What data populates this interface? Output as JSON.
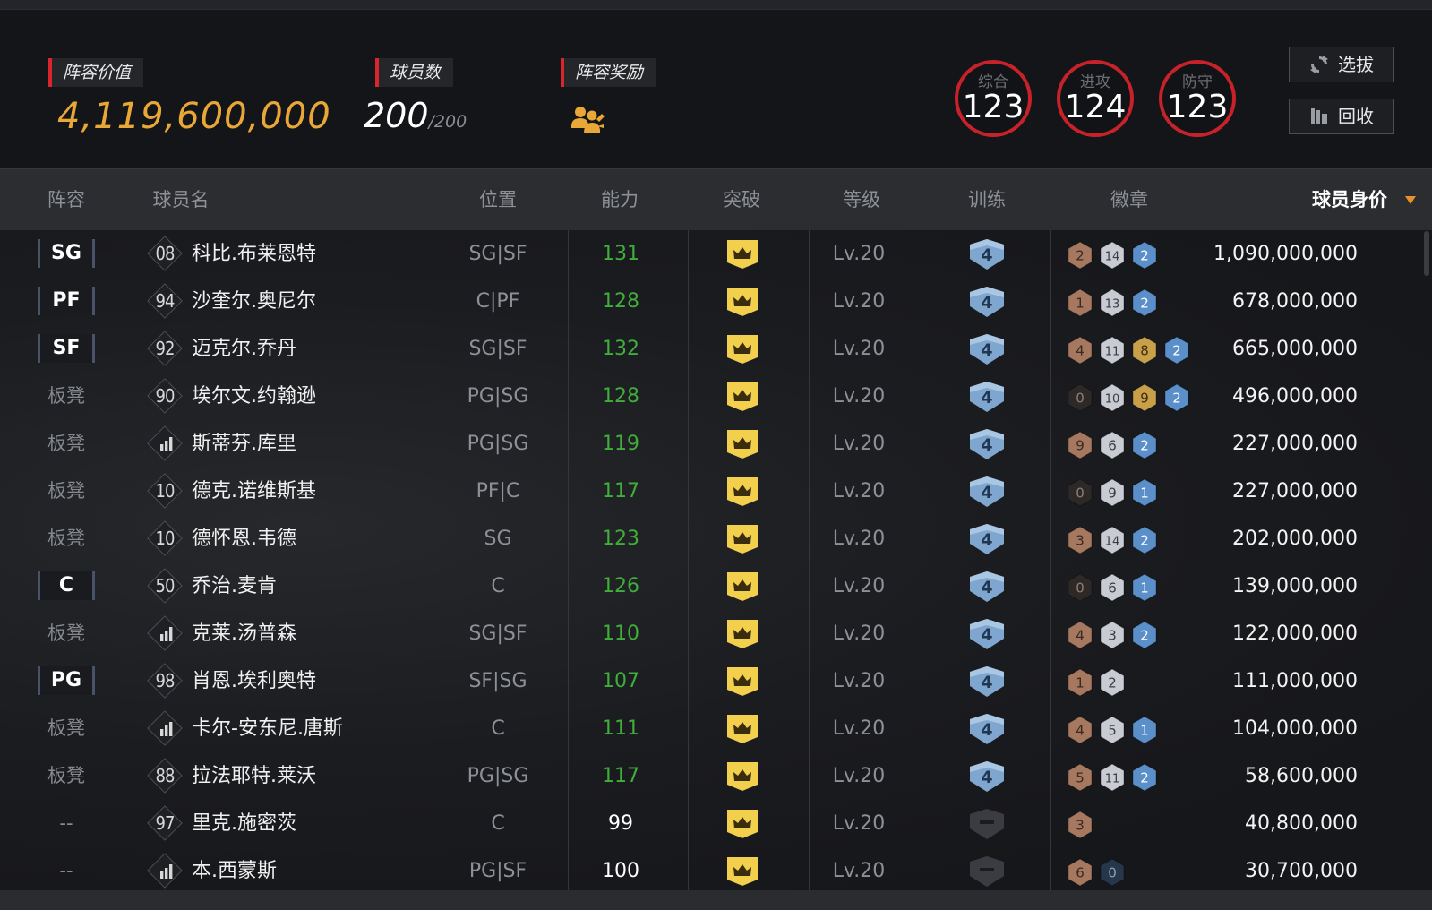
{
  "header": {
    "roster_value_label": "阵容价值",
    "roster_value": "4,119,600,000",
    "player_count_label": "球员数",
    "player_count": "200",
    "player_count_max": "/200",
    "roster_reward_label": "阵容奖励",
    "reward_icon": "team-reward-icon",
    "ratings": [
      {
        "label": "综合",
        "value": "123"
      },
      {
        "label": "进攻",
        "value": "124"
      },
      {
        "label": "防守",
        "value": "123"
      }
    ],
    "buttons": {
      "select": "选拔",
      "recycle": "回收"
    }
  },
  "columns": {
    "lineup": "阵容",
    "name": "球员名",
    "position": "位置",
    "ability": "能力",
    "breakthrough": "突破",
    "level": "等级",
    "training": "训练",
    "badges": "徽章",
    "value": "球员身价"
  },
  "colors": {
    "accent_red": "#d8262c",
    "gold": "#e9a737",
    "ability_green": "#3fae3a",
    "sort_arrow": "#e9902b",
    "badge_bronze": "#a5785f",
    "badge_silver": "#c8cbd2",
    "badge_gold": "#c9a04a",
    "badge_blue": "#5b8fca",
    "badge_dark": "#2e2926",
    "badge_darkblue": "#27364a"
  },
  "players": [
    {
      "lineup": "SG",
      "starter": true,
      "jersey": "08",
      "name": "科比.布莱恩特",
      "position": "SG|SF",
      "ability": "131",
      "level": "Lv.20",
      "training": "4",
      "value": "1,090,000,000",
      "badges": [
        {
          "value": "2",
          "tier": "bronze"
        },
        {
          "value": "14",
          "tier": "silver"
        },
        {
          "value": "2",
          "tier": "blue"
        }
      ]
    },
    {
      "lineup": "PF",
      "starter": true,
      "jersey": "94",
      "name": "沙奎尔.奥尼尔",
      "position": "C|PF",
      "ability": "128",
      "level": "Lv.20",
      "training": "4",
      "value": "678,000,000",
      "badges": [
        {
          "value": "1",
          "tier": "bronze"
        },
        {
          "value": "13",
          "tier": "silver"
        },
        {
          "value": "2",
          "tier": "blue"
        }
      ]
    },
    {
      "lineup": "SF",
      "starter": true,
      "jersey": "92",
      "name": "迈克尔.乔丹",
      "position": "SG|SF",
      "ability": "132",
      "level": "Lv.20",
      "training": "4",
      "value": "665,000,000",
      "badges": [
        {
          "value": "4",
          "tier": "bronze"
        },
        {
          "value": "11",
          "tier": "silver"
        },
        {
          "value": "8",
          "tier": "gold"
        },
        {
          "value": "2",
          "tier": "blue"
        }
      ]
    },
    {
      "lineup": "板凳",
      "starter": false,
      "jersey": "90",
      "name": "埃尔文.约翰逊",
      "position": "PG|SG",
      "ability": "128",
      "level": "Lv.20",
      "training": "4",
      "value": "496,000,000",
      "badges": [
        {
          "value": "0",
          "tier": "dark"
        },
        {
          "value": "10",
          "tier": "silver"
        },
        {
          "value": "9",
          "tier": "gold"
        },
        {
          "value": "2",
          "tier": "blue"
        }
      ]
    },
    {
      "lineup": "板凳",
      "starter": false,
      "jersey": "",
      "name": "斯蒂芬.库里",
      "position": "PG|SG",
      "ability": "119",
      "level": "Lv.20",
      "training": "4",
      "value": "227,000,000",
      "badges": [
        {
          "value": "9",
          "tier": "bronze"
        },
        {
          "value": "6",
          "tier": "silver"
        },
        {
          "value": "2",
          "tier": "blue"
        }
      ]
    },
    {
      "lineup": "板凳",
      "starter": false,
      "jersey": "10",
      "name": "德克.诺维斯基",
      "position": "PF|C",
      "ability": "117",
      "level": "Lv.20",
      "training": "4",
      "value": "227,000,000",
      "badges": [
        {
          "value": "0",
          "tier": "dark"
        },
        {
          "value": "9",
          "tier": "silver"
        },
        {
          "value": "1",
          "tier": "blue"
        }
      ]
    },
    {
      "lineup": "板凳",
      "starter": false,
      "jersey": "10",
      "name": "德怀恩.韦德",
      "position": "SG",
      "ability": "123",
      "level": "Lv.20",
      "training": "4",
      "value": "202,000,000",
      "badges": [
        {
          "value": "3",
          "tier": "bronze"
        },
        {
          "value": "14",
          "tier": "silver"
        },
        {
          "value": "2",
          "tier": "blue"
        }
      ]
    },
    {
      "lineup": "C",
      "starter": true,
      "jersey": "50",
      "name": "乔治.麦肯",
      "position": "C",
      "ability": "126",
      "level": "Lv.20",
      "training": "4",
      "value": "139,000,000",
      "badges": [
        {
          "value": "0",
          "tier": "dark"
        },
        {
          "value": "6",
          "tier": "silver"
        },
        {
          "value": "1",
          "tier": "blue"
        }
      ]
    },
    {
      "lineup": "板凳",
      "starter": false,
      "jersey": "",
      "name": "克莱.汤普森",
      "position": "SG|SF",
      "ability": "110",
      "level": "Lv.20",
      "training": "4",
      "value": "122,000,000",
      "badges": [
        {
          "value": "4",
          "tier": "bronze"
        },
        {
          "value": "3",
          "tier": "silver"
        },
        {
          "value": "2",
          "tier": "blue"
        }
      ]
    },
    {
      "lineup": "PG",
      "starter": true,
      "jersey": "98",
      "name": "肖恩.埃利奥特",
      "position": "SF|SG",
      "ability": "107",
      "level": "Lv.20",
      "training": "4",
      "value": "111,000,000",
      "badges": [
        {
          "value": "1",
          "tier": "bronze"
        },
        {
          "value": "2",
          "tier": "silver"
        }
      ]
    },
    {
      "lineup": "板凳",
      "starter": false,
      "jersey": "",
      "name": "卡尔-安东尼.唐斯",
      "position": "C",
      "ability": "111",
      "level": "Lv.20",
      "training": "4",
      "value": "104,000,000",
      "badges": [
        {
          "value": "4",
          "tier": "bronze"
        },
        {
          "value": "5",
          "tier": "silver"
        },
        {
          "value": "1",
          "tier": "blue"
        }
      ]
    },
    {
      "lineup": "板凳",
      "starter": false,
      "jersey": "88",
      "name": "拉法耶特.莱沃",
      "position": "PG|SG",
      "ability": "117",
      "level": "Lv.20",
      "training": "4",
      "value": "58,600,000",
      "badges": [
        {
          "value": "5",
          "tier": "bronze"
        },
        {
          "value": "11",
          "tier": "silver"
        },
        {
          "value": "2",
          "tier": "blue"
        }
      ]
    },
    {
      "lineup": "--",
      "starter": false,
      "jersey": "97",
      "name": "里克.施密茨",
      "position": "C",
      "ability": "99",
      "level": "Lv.20",
      "training": "",
      "value": "40,800,000",
      "badges": [
        {
          "value": "3",
          "tier": "bronze"
        }
      ]
    },
    {
      "lineup": "--",
      "starter": false,
      "jersey": "",
      "name": "本.西蒙斯",
      "position": "PG|SF",
      "ability": "100",
      "level": "Lv.20",
      "training": "",
      "value": "30,700,000",
      "badges": [
        {
          "value": "6",
          "tier": "bronze"
        },
        {
          "value": "0",
          "tier": "darkblue"
        }
      ]
    }
  ]
}
